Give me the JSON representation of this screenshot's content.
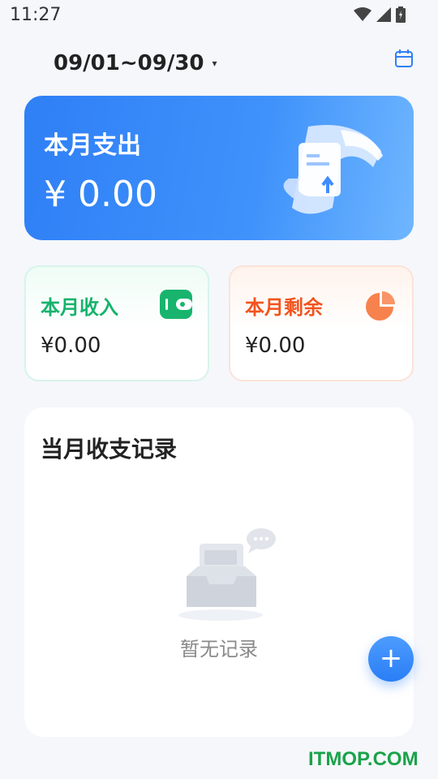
{
  "status_bar": {
    "time": "11:27",
    "icons": [
      "wifi-icon",
      "signal-icon",
      "battery-icon"
    ]
  },
  "header": {
    "date_range": "09/01~09/30",
    "caret": "▾",
    "calendar_icon": "calendar-icon"
  },
  "expense": {
    "title": "本月支出",
    "amount": "¥ 0.00"
  },
  "income": {
    "title": "本月收入",
    "amount": "¥0.00",
    "icon": "wallet-icon"
  },
  "remaining": {
    "title": "本月剩余",
    "amount": "¥0.00",
    "icon": "pie-chart-icon"
  },
  "records": {
    "title": "当月收支记录",
    "empty_text": "暂无记录"
  },
  "fab": {
    "label": "+"
  },
  "watermark": "ITMOP.COM",
  "colors": {
    "primary": "#2f7ff6",
    "income_green": "#16b36c",
    "remaining_orange": "#f2531d",
    "background": "#f5f7fb"
  }
}
